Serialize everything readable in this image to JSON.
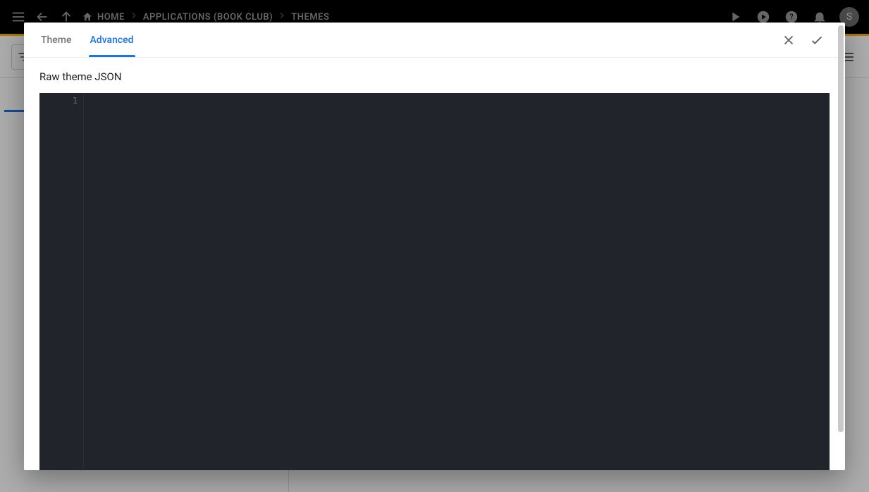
{
  "topbar": {
    "breadcrumbs": {
      "home": "HOME",
      "applications": "APPLICATIONS (BOOK CLUB)",
      "themes": "THEMES"
    },
    "avatar_initial": "S"
  },
  "modal": {
    "tabs": {
      "theme": "Theme",
      "advanced": "Advanced"
    },
    "section_title": "Raw theme JSON",
    "editor": {
      "line_numbers": {
        "l1": "1"
      },
      "content": ""
    }
  }
}
